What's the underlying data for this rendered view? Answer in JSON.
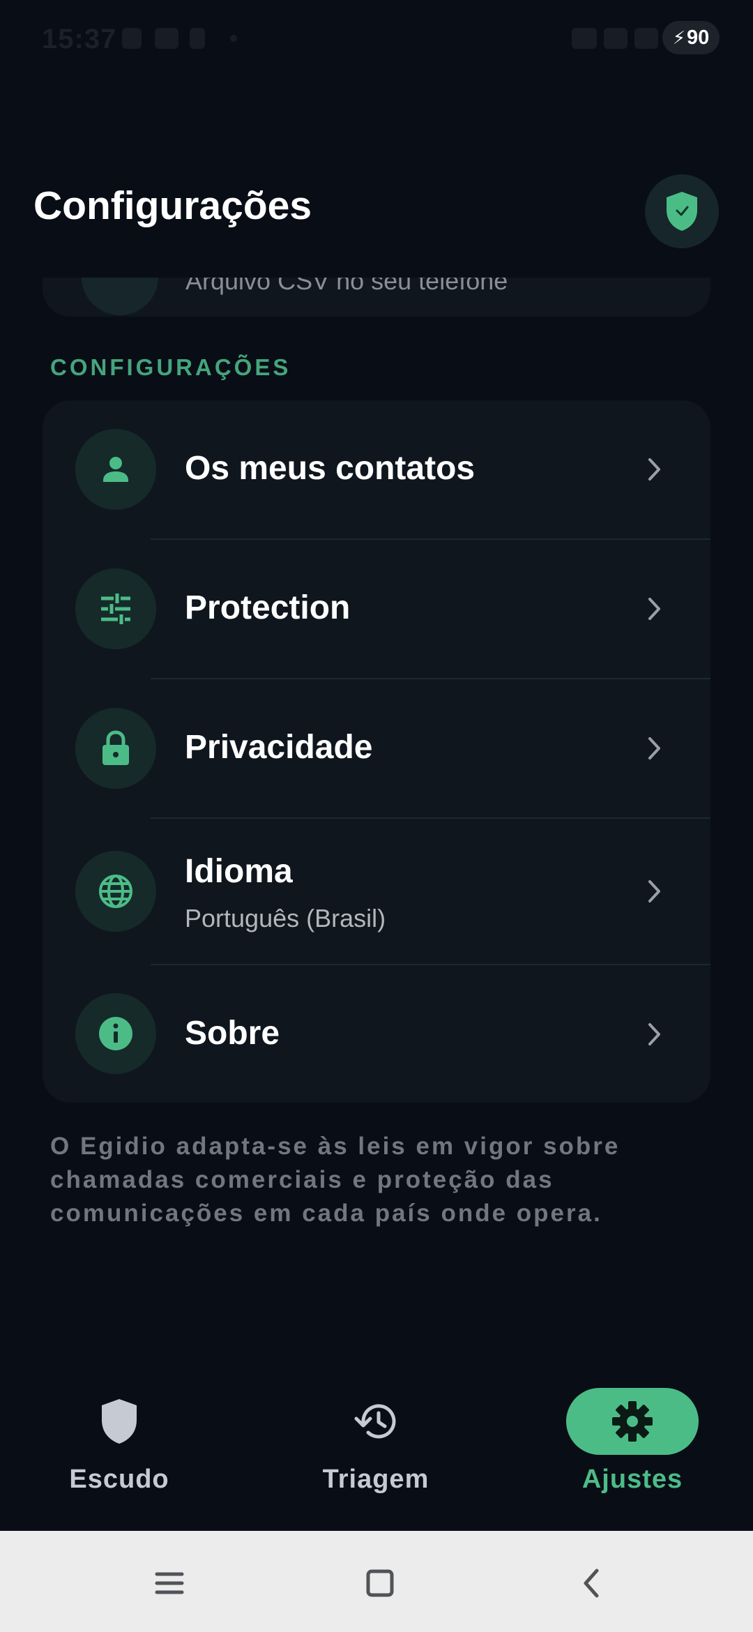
{
  "status_bar": {
    "time": "15:37",
    "battery": "90"
  },
  "header": {
    "title": "Configurações",
    "badge_icon": "shield-check-icon"
  },
  "previous_card": {
    "subtitle": "Arquivo CSV no seu telefone"
  },
  "section": {
    "label": "CONFIGURAÇÕES"
  },
  "settings": [
    {
      "icon": "person-icon",
      "label": "Os meus contatos"
    },
    {
      "icon": "sliders-icon",
      "label": "Protection"
    },
    {
      "icon": "lock-icon",
      "label": "Privacidade"
    },
    {
      "icon": "globe-icon",
      "label": "Idioma",
      "sublabel": "Português (Brasil)"
    },
    {
      "icon": "info-icon",
      "label": "Sobre"
    }
  ],
  "footer_note": "O Egidio adapta-se às leis em vigor sobre chamadas comerciais e proteção das comunicações em cada país onde opera.",
  "bottom_nav": [
    {
      "icon": "shield-icon",
      "label": "Escudo",
      "active": false
    },
    {
      "icon": "history-icon",
      "label": "Triagem",
      "active": false
    },
    {
      "icon": "gear-icon",
      "label": "Ajustes",
      "active": true
    }
  ],
  "colors": {
    "background": "#090d16",
    "card": "#0f161e",
    "accent": "#4cbc87",
    "section_label": "#45a57c",
    "icon_circle": "#162a2a"
  }
}
